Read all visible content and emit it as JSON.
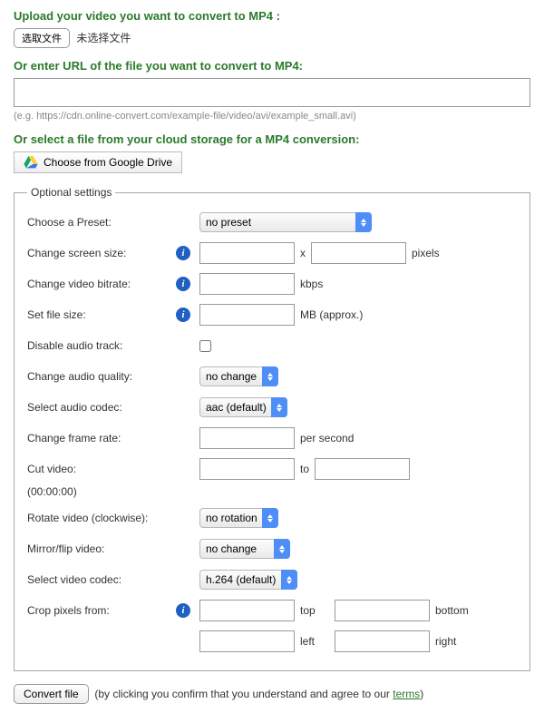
{
  "upload": {
    "heading": "Upload your video you want to convert to MP4 :",
    "button": "选取文件",
    "no_file": "未选择文件"
  },
  "url": {
    "heading": "Or enter URL of the file you want to convert to MP4:",
    "value": "",
    "example": "(e.g. https://cdn.online-convert.com/example-file/video/avi/example_small.avi)"
  },
  "cloud": {
    "heading": "Or select a file from your cloud storage for a MP4 conversion:",
    "gdrive": "Choose from Google Drive"
  },
  "optional": {
    "legend": "Optional settings",
    "preset": {
      "label": "Choose a Preset:",
      "value": "no preset"
    },
    "screen": {
      "label": "Change screen size:",
      "x": "x",
      "suffix": "pixels"
    },
    "bitrate": {
      "label": "Change video bitrate:",
      "suffix": "kbps"
    },
    "filesize": {
      "label": "Set file size:",
      "suffix": "MB (approx.)"
    },
    "disable_audio": {
      "label": "Disable audio track:"
    },
    "audio_quality": {
      "label": "Change audio quality:",
      "value": "no change"
    },
    "audio_codec": {
      "label": "Select audio codec:",
      "value": "aac (default)"
    },
    "framerate": {
      "label": "Change frame rate:",
      "suffix": "per second"
    },
    "cut": {
      "label": "Cut video:",
      "to": "to",
      "hint": "(00:00:00)"
    },
    "rotate": {
      "label": "Rotate video (clockwise):",
      "value": "no rotation"
    },
    "mirror": {
      "label": "Mirror/flip video:",
      "value": "no change"
    },
    "video_codec": {
      "label": "Select video codec:",
      "value": "h.264 (default)"
    },
    "crop": {
      "label": "Crop pixels from:",
      "top": "top",
      "bottom": "bottom",
      "left": "left",
      "right": "right"
    }
  },
  "submit": {
    "button": "Convert file",
    "disclaimer_pre": "(by clicking you confirm that you understand and agree to our ",
    "terms": "terms",
    "disclaimer_post": ")"
  }
}
